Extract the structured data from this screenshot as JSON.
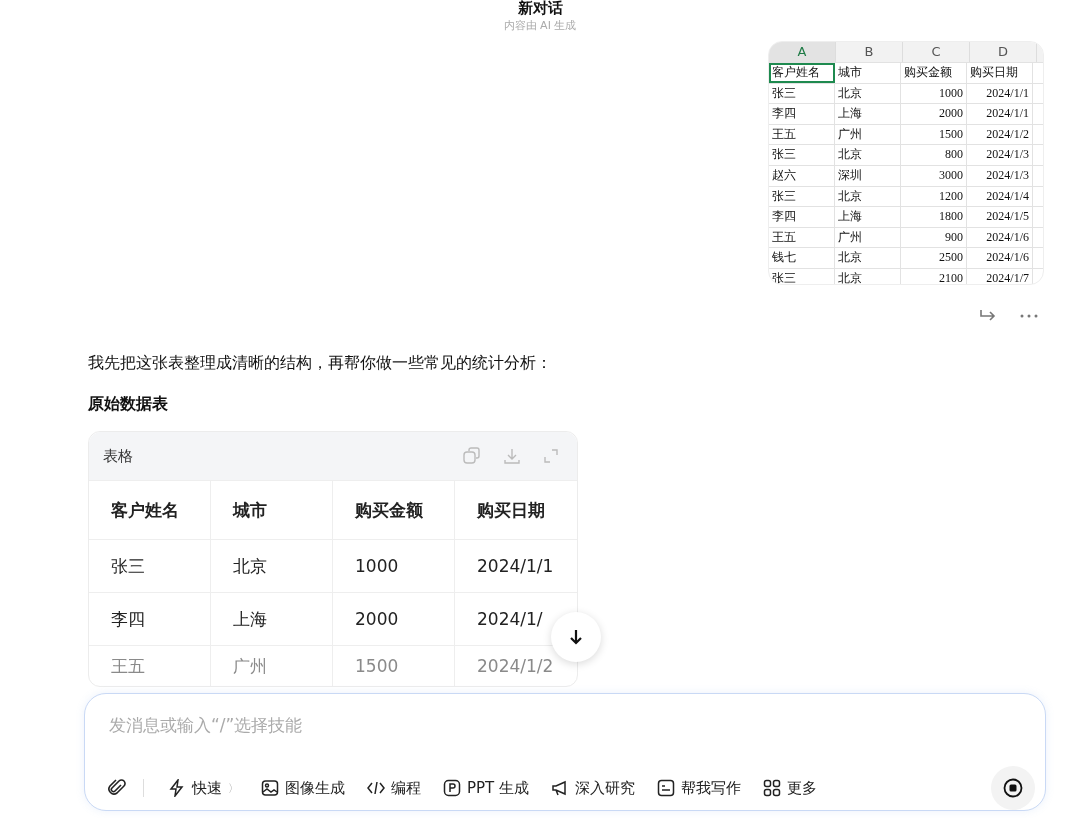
{
  "header": {
    "title": "新对话",
    "subtitle": "内容由 AI 生成"
  },
  "attachment": {
    "kind": "spreadsheet",
    "columns": [
      {
        "label": "A",
        "selected": true
      },
      {
        "label": "B",
        "selected": false
      },
      {
        "label": "C",
        "selected": false
      },
      {
        "label": "D",
        "selected": false
      }
    ],
    "rows": [
      [
        "客户姓名",
        "城市",
        "购买金额",
        "购买日期"
      ],
      [
        "张三",
        "北京",
        "1000",
        "2024/1/1"
      ],
      [
        "李四",
        "上海",
        "2000",
        "2024/1/1"
      ],
      [
        "王五",
        "广州",
        "1500",
        "2024/1/2"
      ],
      [
        "张三",
        "北京",
        "800",
        "2024/1/3"
      ],
      [
        "赵六",
        "深圳",
        "3000",
        "2024/1/3"
      ],
      [
        "张三",
        "北京",
        "1200",
        "2024/1/4"
      ],
      [
        "李四",
        "上海",
        "1800",
        "2024/1/5"
      ],
      [
        "王五",
        "广州",
        "900",
        "2024/1/6"
      ],
      [
        "钱七",
        "北京",
        "2500",
        "2024/1/6"
      ],
      [
        "张三",
        "北京",
        "2100",
        "2024/1/7"
      ]
    ]
  },
  "reply": {
    "intro": "我先把这张表整理成清晰的结构，再帮你做一些常见的统计分析：",
    "heading": "原始数据表",
    "table": {
      "title": "表格",
      "columns": [
        "客户姓名",
        "城市",
        "购买金额",
        "购买日期"
      ],
      "rows": [
        {
          "cells": [
            "张三",
            "北京",
            "1000",
            "2024/1/1"
          ],
          "faded": false
        },
        {
          "cells": [
            "李四",
            "上海",
            "2000",
            "2024/1/"
          ],
          "faded": false
        },
        {
          "cells": [
            "王五",
            "广州",
            "1500",
            "2024/1/2"
          ],
          "faded": true
        }
      ]
    }
  },
  "composer": {
    "placeholder": "发消息或输入“/”选择技能",
    "tools": [
      {
        "kind": "bolt",
        "label": "快速",
        "caret": "〉"
      },
      {
        "kind": "image",
        "label": "图像生成"
      },
      {
        "kind": "code",
        "label": "编程"
      },
      {
        "kind": "ppt",
        "label": "PPT 生成"
      },
      {
        "kind": "megaphone",
        "label": "深入研究"
      },
      {
        "kind": "doc",
        "label": "帮我写作"
      },
      {
        "kind": "grid",
        "label": "更多"
      }
    ]
  }
}
